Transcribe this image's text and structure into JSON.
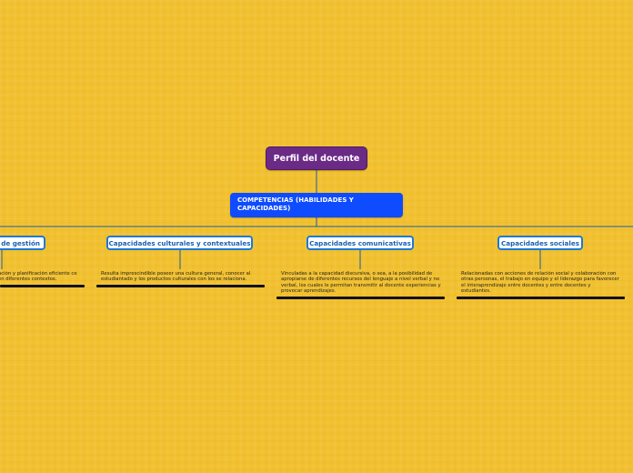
{
  "map": {
    "root": {
      "title": "Perfil del docente"
    },
    "competencias": {
      "title": "COMPETENCIAS (HABILIDADES Y CAPACIDADES)"
    },
    "capacidades": [
      {
        "title": "de gestión",
        "description": "ación y planificación eficiente ce en diferentes contextos."
      },
      {
        "title": "Capacidades culturales y contextuales",
        "description": "Resulta imprescindible poseer una cultura general, conocer al estudiantado y los productos culturales con los se relaciona."
      },
      {
        "title": "Capacidades comunicativas",
        "description": "Vinculadas a la capacidad discursiva, o sea, a la posibilidad de apropiarse de diferentes recursos del lenguaje a nivel verbal y no verbal, los cuales le permitan transmitir al docente experiencias y provocar aprendizajes."
      },
      {
        "title": "Capacidades sociales",
        "description": "Relacionadas con acciones de relación social y colaboración con otras personas, el trabajo en equipo y el liderazgo para favorecer el interaprendizaje entre docentes y entre docentes y estudiantes."
      }
    ]
  },
  "colors": {
    "background": "#f2c12e",
    "root_fill": "#6b2a86",
    "sub_fill": "#0f4cff",
    "cap_border": "#1b7ad6",
    "cap_text": "#1b5fb3"
  }
}
